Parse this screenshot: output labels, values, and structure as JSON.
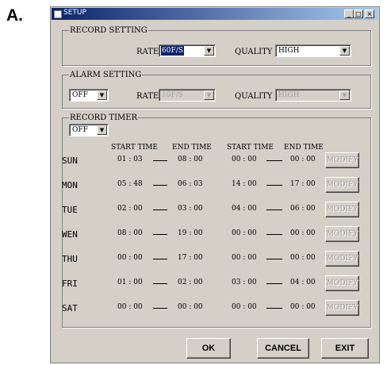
{
  "figure_label": "A.",
  "window": {
    "title": "SETUP",
    "min_glyph": "_",
    "max_glyph": "□",
    "close_glyph": "×"
  },
  "record_setting": {
    "legend": "RECORD SETTING",
    "rate_label": "RATE",
    "rate_value": "60F/S",
    "quality_label": "QUALITY",
    "quality_value": "HIGH"
  },
  "alarm_setting": {
    "legend": "ALARM SETTING",
    "mode_value": "OFF",
    "rate_label": "RATE",
    "rate_value": "10F/S",
    "quality_label": "QUALITY",
    "quality_value": "HIGH"
  },
  "record_timer": {
    "legend": "RECORD TIMER",
    "mode_value": "OFF",
    "headers": [
      "START TIME",
      "END TIME",
      "START TIME",
      "END TIME"
    ],
    "modify_label": "MODIFY",
    "rows": [
      {
        "day": "SUN",
        "s1": "01 : 03",
        "e1": "08 : 00",
        "s2": "00 : 00",
        "e2": "00 : 00"
      },
      {
        "day": "MON",
        "s1": "05 : 48",
        "e1": "06 : 03",
        "s2": "14 : 00",
        "e2": "17 : 00"
      },
      {
        "day": "TUE",
        "s1": "02 : 00",
        "e1": "03 : 00",
        "s2": "04 : 00",
        "e2": "06 : 00"
      },
      {
        "day": "WEN",
        "s1": "08 : 00",
        "e1": "19 : 00",
        "s2": "00 : 00",
        "e2": "00 : 00"
      },
      {
        "day": "THU",
        "s1": "00 : 00",
        "e1": "17 : 00",
        "s2": "00 : 00",
        "e2": "00 : 00"
      },
      {
        "day": "FRI",
        "s1": "01 : 00",
        "e1": "02 : 00",
        "s2": "03 : 00",
        "e2": "04 : 00"
      },
      {
        "day": "SAT",
        "s1": "00 : 00",
        "e1": "00 : 00",
        "s2": "00 : 00",
        "e2": "00 : 00"
      }
    ]
  },
  "buttons": {
    "ok": "OK",
    "cancel": "CANCEL",
    "exit": "EXIT"
  }
}
